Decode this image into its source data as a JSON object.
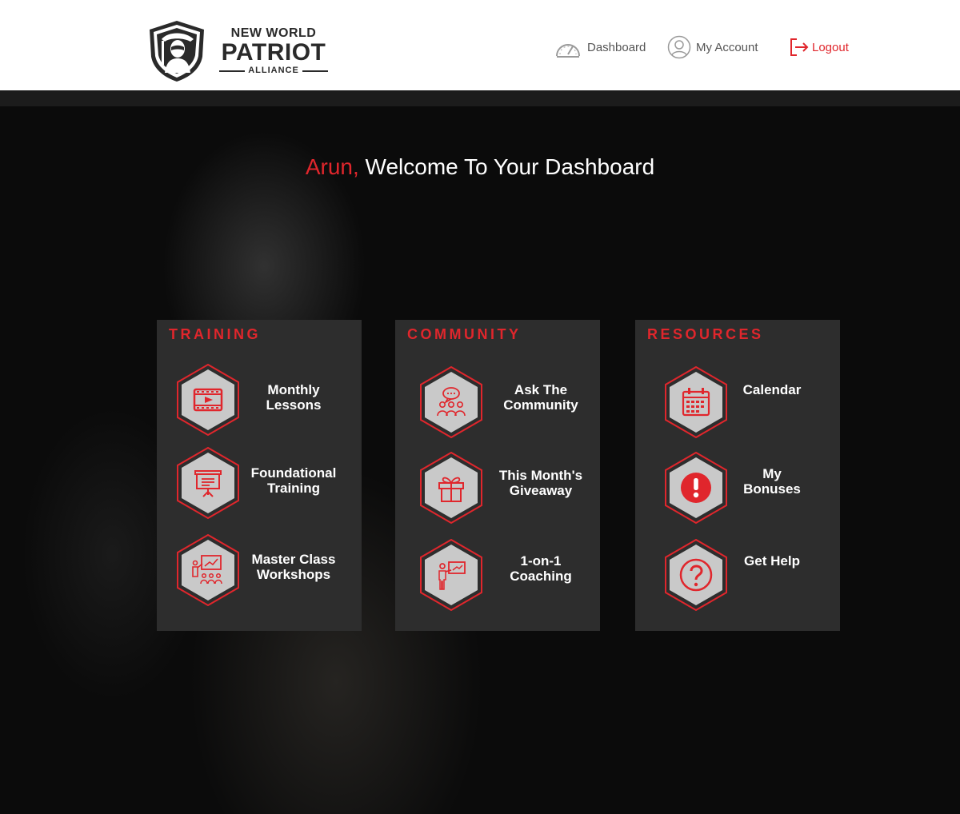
{
  "brand": {
    "line1": "NEW WORLD",
    "line2": "PATRIOT",
    "line3": "ALLIANCE"
  },
  "nav": {
    "dashboard": "Dashboard",
    "my_account": "My Account",
    "logout": "Logout"
  },
  "welcome": {
    "user_name": "Arun,",
    "message": " Welcome To Your Dashboard"
  },
  "colors": {
    "accent": "#e0262c",
    "panel_bg": "#2d2d2d",
    "hex_fill": "#c9c9c9"
  },
  "panels": [
    {
      "title": "TRAINING",
      "items": [
        {
          "label_lines": [
            "Monthly",
            "Lessons"
          ],
          "icon": "video-icon"
        },
        {
          "label_lines": [
            "Foundational",
            "Training"
          ],
          "icon": "presentation-board-icon"
        },
        {
          "label_lines": [
            "Master Class",
            "Workshops"
          ],
          "icon": "workshop-presenter-icon"
        }
      ]
    },
    {
      "title": "COMMUNITY",
      "items": [
        {
          "label_lines": [
            "Ask The",
            "Community"
          ],
          "icon": "community-chat-icon"
        },
        {
          "label_lines": [
            "This Month's",
            "Giveaway"
          ],
          "icon": "gift-icon"
        },
        {
          "label_lines": [
            "1-on-1",
            "Coaching"
          ],
          "icon": "coaching-icon"
        }
      ]
    },
    {
      "title": "RESOURCES",
      "items": [
        {
          "label_lines": [
            "Calendar"
          ],
          "icon": "calendar-icon"
        },
        {
          "label_lines": [
            "My",
            "Bonuses"
          ],
          "icon": "exclamation-icon"
        },
        {
          "label_lines": [
            "Get Help"
          ],
          "icon": "question-icon"
        }
      ]
    }
  ]
}
